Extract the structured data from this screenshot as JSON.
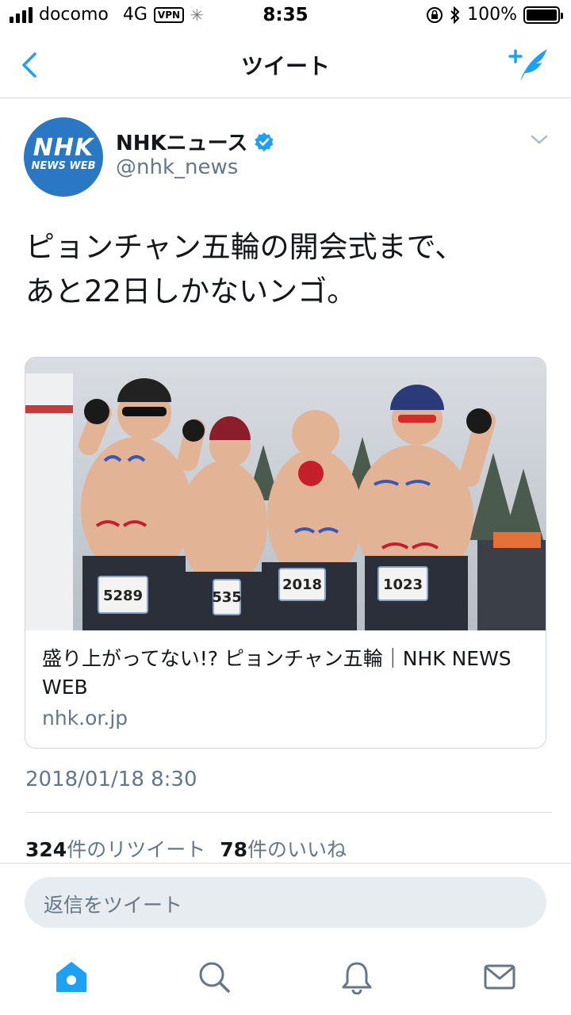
{
  "status_bar": {
    "carrier": "docomo",
    "network": "4G",
    "vpn": "VPN",
    "time": "8:35",
    "battery": "100%",
    "battery_level": 1.0
  },
  "nav": {
    "title": "ツイート",
    "back_icon": "chevron-left-icon",
    "compose_icon": "compose-tweet-icon"
  },
  "tweet": {
    "avatar": {
      "line1": "NHK",
      "line2": "NEWS WEB"
    },
    "display_name": "NHKニュース",
    "handle": "@nhk_news",
    "text": "ピョンチャン五輪の開会式まで、\nあと22日しかないンゴ。",
    "card": {
      "title": "盛り上がってない!? ピョンチャン五輪｜NHK NEWS WEB",
      "domain": "nhk.or.jp",
      "bibs": [
        "5289",
        "535",
        "2018",
        "1023"
      ]
    },
    "timestamp": "2018/01/18 8:30",
    "retweets_count": "324",
    "retweets_label": "件のリツイート",
    "likes_count": "78",
    "likes_label": "件のいいね"
  },
  "reply": {
    "placeholder": "返信をツイート"
  },
  "tabbar": {
    "items": [
      "home-icon",
      "search-icon",
      "notifications-icon",
      "messages-icon"
    ]
  },
  "colors": {
    "accent": "#1da1f2",
    "avatar": "#2a78c4",
    "muted": "#657786"
  }
}
